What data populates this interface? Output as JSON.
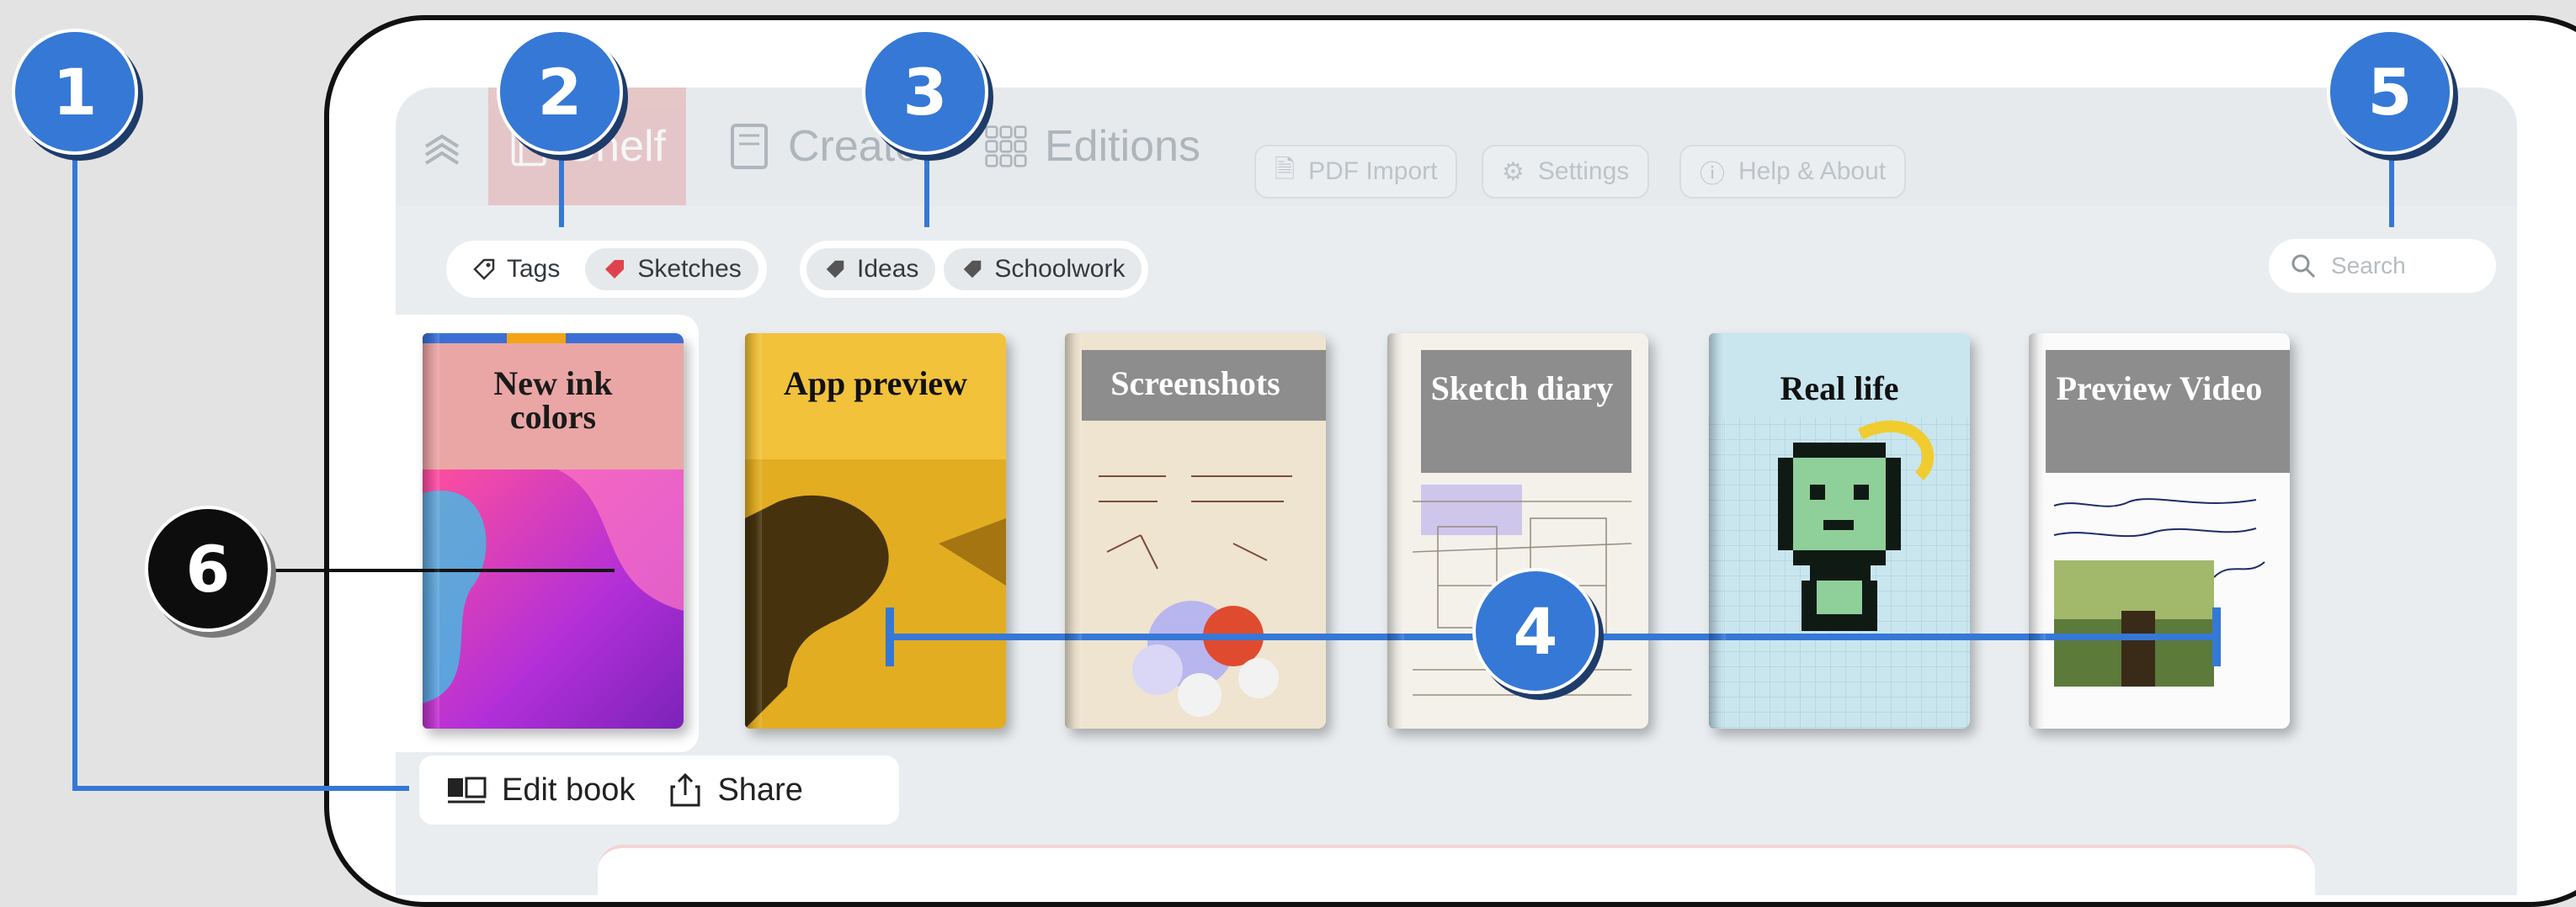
{
  "nav": {
    "tabs": [
      {
        "label": "Shelf",
        "icon": "book-icon"
      },
      {
        "label": "Create",
        "icon": "notebook-icon"
      },
      {
        "label": "Editions",
        "icon": "grid-icon"
      }
    ],
    "buttons": [
      {
        "label": "PDF Import",
        "icon": "pdf-icon"
      },
      {
        "label": "Settings",
        "icon": "gear-icon"
      },
      {
        "label": "Help & About",
        "icon": "info-icon"
      }
    ]
  },
  "filters": {
    "tags_label": "Tags",
    "tags": [
      "Sketches",
      "Ideas",
      "Schoolwork"
    ]
  },
  "search": {
    "placeholder": "Search"
  },
  "books": [
    {
      "title": "New ink colors",
      "cover": "gradient"
    },
    {
      "title": "App preview",
      "cover": "yellow"
    },
    {
      "title": "Screenshots",
      "cover": "chemistry"
    },
    {
      "title": "Sketch diary",
      "cover": "sketch"
    },
    {
      "title": "Real life",
      "cover": "pixel"
    },
    {
      "title": "Preview Video",
      "cover": "photo"
    }
  ],
  "actions": {
    "edit": "Edit book",
    "share": "Share"
  },
  "callouts": [
    "1",
    "2",
    "3",
    "4",
    "5",
    "6"
  ],
  "colors": {
    "callout": "#3578d6",
    "callout_dark": "#0d0d0d",
    "shelf_active": "#e3a8a8"
  }
}
